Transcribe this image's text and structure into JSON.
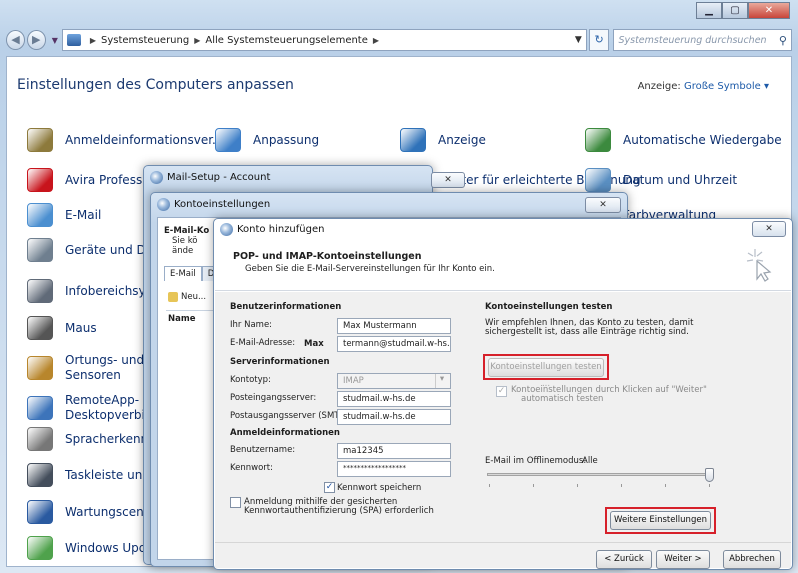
{
  "control_panel": {
    "breadcrumb": [
      "Systemsteuerung",
      "Alle Systemsteuerungselemente"
    ],
    "search_placeholder": "Systemsteuerung durchsuchen",
    "header": "Einstellungen des Computers anpassen",
    "view_label": "Anzeige:",
    "view_value": "Große Symbole ▾",
    "items": [
      {
        "label": "Anmeldeinformationsver...",
        "icon": "credential-manager-icon",
        "color": "#8d7a3c"
      },
      {
        "label": "Anpassung",
        "icon": "personalization-icon",
        "color": "#3e7fc8"
      },
      {
        "label": "Anzeige",
        "icon": "display-icon",
        "color": "#2f72b9"
      },
      {
        "label": "Automatische Wiedergabe",
        "icon": "autoplay-icon",
        "color": "#3c8a3e"
      },
      {
        "label": "Avira Profession",
        "icon": "avira-icon",
        "color": "#c8141c"
      },
      {
        "label": "Center für erleichterte Bedienung",
        "icon": "ease-of-access-icon",
        "color": "#2a69b4"
      },
      {
        "label": "Datum und Uhrzeit",
        "icon": "date-time-icon",
        "color": "#5a8fc2"
      },
      {
        "label": "E-Mail",
        "icon": "mail-icon",
        "color": "#4b8fd0"
      },
      {
        "label": "Farbverwaltung",
        "icon": "color-management-icon",
        "color": "#6a9ec4"
      },
      {
        "label": "Geräte und Druc",
        "icon": "devices-printers-icon",
        "color": "#6f7f8f"
      },
      {
        "label": "Infobereichsymb",
        "icon": "notification-area-icon",
        "color": "#606a78"
      },
      {
        "label": "Maus",
        "icon": "mouse-icon",
        "color": "#555"
      },
      {
        "label": "Ortungs- und ar\nSensoren",
        "icon": "location-sensors-icon",
        "color": "#b8862c"
      },
      {
        "label": "RemoteApp- und\nDesktopverbindu",
        "icon": "remoteapp-icon",
        "color": "#3d74ba"
      },
      {
        "label": "Spracherkennung",
        "icon": "microphone-icon",
        "color": "#777"
      },
      {
        "label": "Taskleiste und Sta",
        "icon": "taskbar-icon",
        "color": "#444e5c"
      },
      {
        "label": "Wartungscenter",
        "icon": "action-center-flag-icon",
        "color": "#2a5aa0"
      },
      {
        "label": "Windows Update",
        "icon": "windows-update-icon",
        "color": "#4fa24c"
      }
    ]
  },
  "mail_setup": {
    "title": "Mail-Setup - Account"
  },
  "konto_einstellungen": {
    "title": "Kontoeinstellungen",
    "header_title": "E-Mail-Ko",
    "header_sub1": "Sie kö",
    "header_sub2": "ände",
    "tabs": [
      "E-Mail",
      "Da"
    ],
    "new_label": "Neu...",
    "column_name": "Name"
  },
  "konto_hinzufuegen": {
    "title": "Konto hinzufügen",
    "heading": "POP- und IMAP-Kontoeinstellungen",
    "subheading": "Geben Sie die E-Mail-Servereinstellungen für Ihr Konto ein.",
    "benutzerinfo": "Benutzerinformationen",
    "name_label": "Ihr Name:",
    "name_value": "Max Mustermann",
    "email_label": "E-Mail-Adresse:",
    "email_prefix": "Max",
    "email_value": "termann@studmail.w-hs.de",
    "serverinfo": "Serverinformationen",
    "kontotyp_label": "Kontotyp:",
    "kontotyp_value": "IMAP",
    "posteingang_label": "Posteingangsserver:",
    "posteingang_value": "studmail.w-hs.de",
    "postausgang_label": "Postausgangsserver (SMTP):",
    "postausgang_value": "studmail.w-hs.de",
    "anmeldeinfo": "Anmeldeinformationen",
    "benutzername_label": "Benutzername:",
    "benutzername_value": "ma12345",
    "kennwort_label": "Kennwort:",
    "kennwort_value": "******************",
    "kennwort_speichern": "Kennwort speichern",
    "spa_line1": "Anmeldung mithilfe der gesicherten",
    "spa_line2": "Kennwortauthentifizierung (SPA) erforderlich",
    "test_title": "Kontoeinstellungen testen",
    "test_desc1": "Wir empfehlen Ihnen, das Konto zu testen, damit",
    "test_desc2": "sichergestellt ist, dass alle Einträge richtig sind.",
    "test_button": "Kontoeinstellungen testen ...",
    "auto_test_line1": "Kontoeinstellungen durch Klicken auf \"Weiter\"",
    "auto_test_line2": "automatisch testen",
    "offline_label": "E-Mail im Offlinemodus:",
    "offline_value": "Alle",
    "more_settings": "Weitere Einstellungen",
    "back_button": "< Zurück",
    "next_button": "Weiter >",
    "cancel_button": "Abbrechen"
  },
  "colors": {
    "highlight": "#d6202a",
    "link": "#0d2f6e"
  }
}
